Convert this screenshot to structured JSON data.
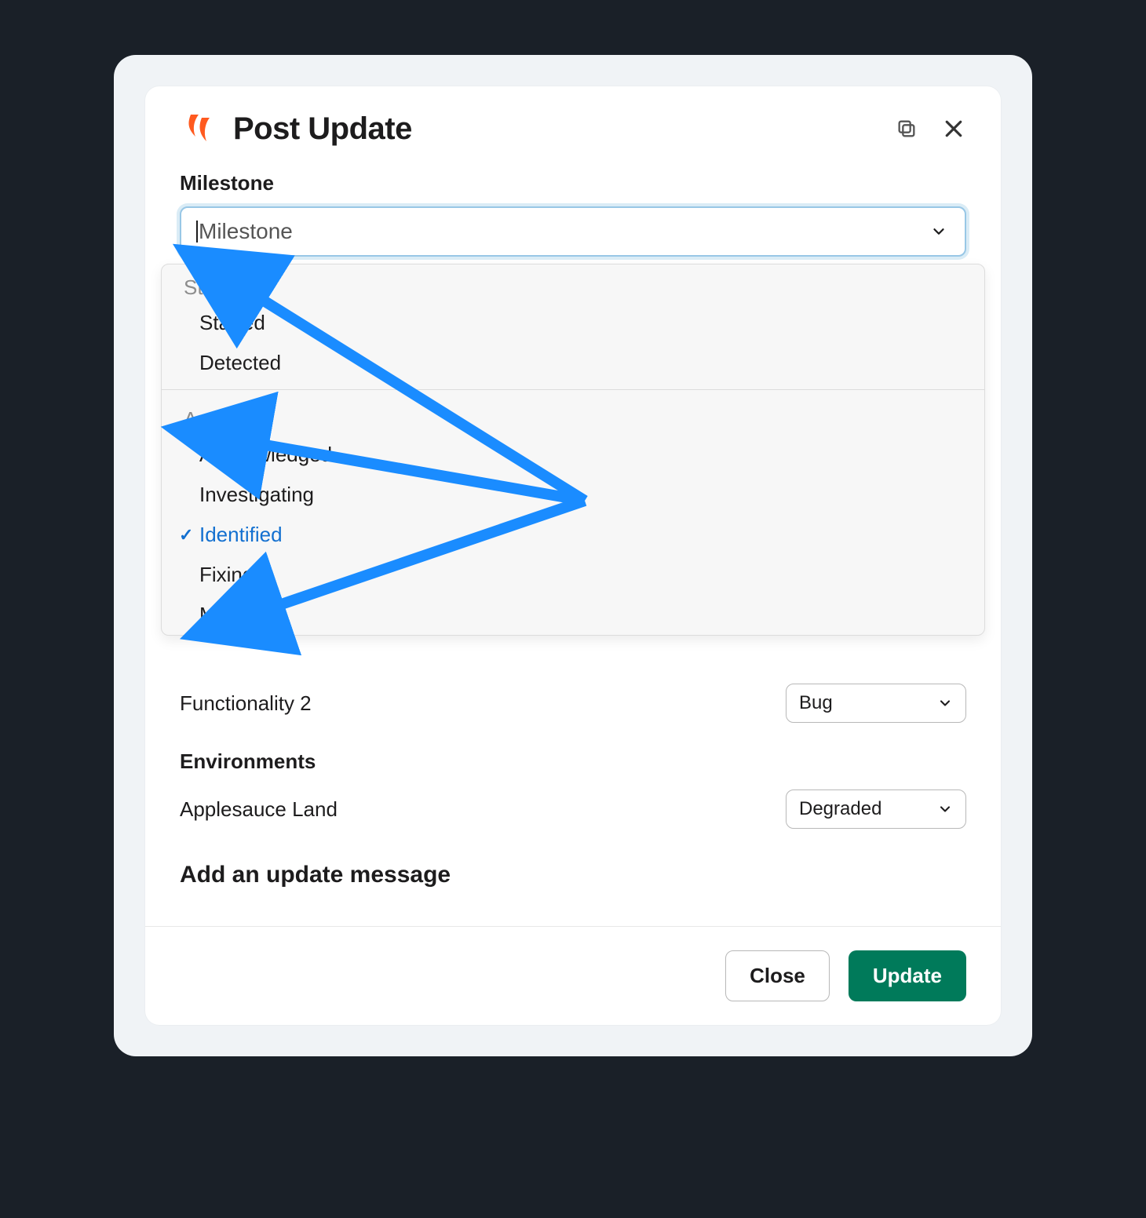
{
  "modal": {
    "title": "Post Update"
  },
  "milestone": {
    "label": "Milestone",
    "placeholder": "Milestone",
    "groups": [
      {
        "label": "Started",
        "options": [
          {
            "label": "Started",
            "selected": false
          },
          {
            "label": "Detected",
            "selected": false
          }
        ]
      },
      {
        "label": "Active",
        "options": [
          {
            "label": "Acknowledged",
            "selected": false
          },
          {
            "label": "Investigating",
            "selected": false
          },
          {
            "label": "Identified",
            "selected": true
          },
          {
            "label": "Fixing",
            "selected": false
          },
          {
            "label": "Mitigated",
            "selected": false
          }
        ]
      }
    ]
  },
  "functionalities": [
    {
      "label": "Functionality 2",
      "value": "Bug"
    }
  ],
  "environments_section": "Environments",
  "environments": [
    {
      "label": "Applesauce Land",
      "value": "Degraded"
    }
  ],
  "update_message_title": "Add an update message",
  "footer": {
    "close": "Close",
    "update": "Update"
  },
  "colors": {
    "accent_blue": "#1a8cff",
    "primary_green": "#007a5a"
  }
}
